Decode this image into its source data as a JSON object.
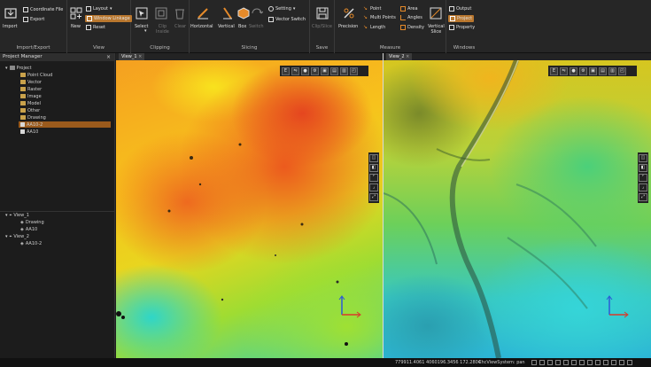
{
  "ribbon": {
    "import_export": {
      "import": "Import",
      "coordinate_file": "Coordinate File",
      "export": "Export",
      "group": "Import/Export"
    },
    "view": {
      "new": "New",
      "layout": "Layout",
      "window_linkage": "Window Linkage",
      "reset": "Reset",
      "group": "View"
    },
    "clipping": {
      "select": "Select",
      "clip_inside": "Clip\nInside",
      "clear": "Clear",
      "group": "Clipping"
    },
    "slicing": {
      "horizontal": "Horizontal",
      "vertical": "Vertical",
      "box": "Box",
      "switch": "Switch",
      "setting": "Setting",
      "vector_switch": "Vector Switch",
      "group": "Slicing"
    },
    "save": {
      "clip_slice": "Clip/Slice",
      "group": "Save"
    },
    "measure": {
      "precision": "Precision",
      "point": "Point",
      "multi_points": "Multi Points",
      "length": "Length",
      "area": "Area",
      "angles": "Angles",
      "density": "Density",
      "vertical_slice": "Vertical\nSlice",
      "group": "Measure"
    },
    "windows": {
      "output": "Output",
      "project": "Project",
      "property": "Property",
      "group": "Windows"
    }
  },
  "project_manager": {
    "title": "Project Manager",
    "close": "×",
    "tree": [
      {
        "label": "Project",
        "level": 0,
        "type": "root"
      },
      {
        "label": "Point Cloud",
        "level": 1,
        "type": "folder"
      },
      {
        "label": "Vector",
        "level": 1,
        "type": "folder"
      },
      {
        "label": "Raster",
        "level": 1,
        "type": "folder"
      },
      {
        "label": "Image",
        "level": 1,
        "type": "folder"
      },
      {
        "label": "Model",
        "level": 1,
        "type": "folder"
      },
      {
        "label": "Other",
        "level": 1,
        "type": "folder"
      },
      {
        "label": "Drawing",
        "level": 1,
        "type": "folder"
      },
      {
        "label": "AA10-2",
        "level": 1,
        "type": "item",
        "selected": true
      },
      {
        "label": "AA10",
        "level": 1,
        "type": "item"
      }
    ],
    "views": [
      {
        "label": "View_1",
        "level": 0
      },
      {
        "label": "Drawing",
        "level": 1
      },
      {
        "label": "AA10",
        "level": 1
      },
      {
        "label": "View_2",
        "level": 0
      },
      {
        "label": "AA10-2",
        "level": 1
      }
    ]
  },
  "tabs": {
    "view1": "View_1",
    "view2": "View_2",
    "close": "×"
  },
  "status": {
    "coordinates": "779911.4061 4060196.3456 172.2804",
    "view_system": "ChcViewSystem: pan"
  },
  "colors": {
    "accent": "#b9772e",
    "panel": "#1c1c1c",
    "ribbon": "#262626"
  }
}
